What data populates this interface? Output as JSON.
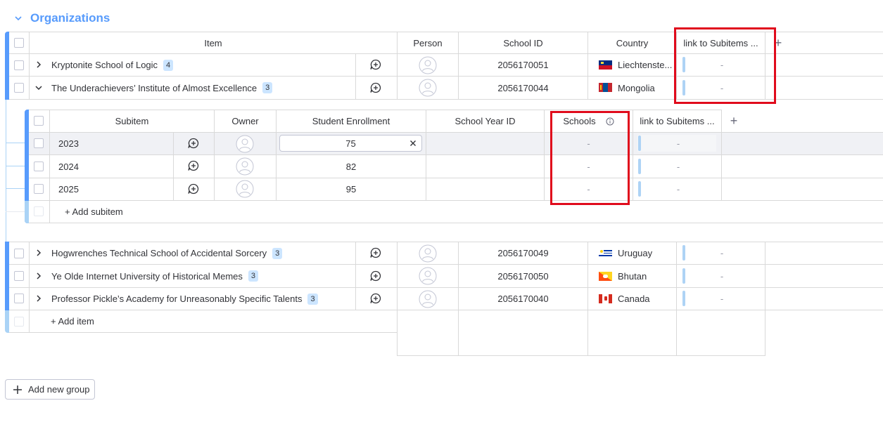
{
  "group": {
    "title": "Organizations",
    "columns": {
      "item": "Item",
      "person": "Person",
      "school_id": "School ID",
      "country": "Country",
      "link": "link to Subitems ...",
      "add": "+"
    },
    "items": [
      {
        "name": "Kryptonite School of Logic",
        "count": "4",
        "school_id": "2056170051",
        "country": "Liechtenste...",
        "flag": "liechtenstein-flag-icon",
        "link": "-"
      },
      {
        "name": "The Underachievers’ Institute of Almost Excellence",
        "count": "3",
        "school_id": "2056170044",
        "country": "Mongolia",
        "flag": "mongolia-flag-icon",
        "link": "-"
      },
      {
        "name": "Hogwrenches Technical School of Accidental Sorcery",
        "count": "3",
        "school_id": "2056170049",
        "country": "Uruguay",
        "flag": "uruguay-flag-icon",
        "link": "-"
      },
      {
        "name": "Ye Olde Internet University of Historical Memes",
        "count": "3",
        "school_id": "2056170050",
        "country": "Bhutan",
        "flag": "bhutan-flag-icon",
        "link": "-"
      },
      {
        "name": "Professor Pickle’s Academy for Unreasonably Specific Talents",
        "count": "3",
        "school_id": "2056170040",
        "country": "Canada",
        "flag": "canada-flag-icon",
        "link": "-"
      }
    ],
    "add_item": "+ Add item"
  },
  "subitems": {
    "columns": {
      "subitem": "Subitem",
      "owner": "Owner",
      "enrollment": "Student Enrollment",
      "year_id": "School Year ID",
      "schools": "Schools",
      "link": "link to Subitems ...",
      "add": "+"
    },
    "rows": [
      {
        "name": "2023",
        "enrollment": "75",
        "schools": "-",
        "link": "-"
      },
      {
        "name": "2024",
        "enrollment": "82",
        "schools": "-",
        "link": "-"
      },
      {
        "name": "2025",
        "enrollment": "95",
        "schools": "-",
        "link": "-"
      }
    ],
    "add_subitem": "+ Add subitem"
  },
  "add_new_group": "Add new group",
  "colors": {
    "group_accent": "#579bfc",
    "highlight": "#e00b1c",
    "badge": "#cce5ff"
  },
  "icons": [
    "chevron-down-icon",
    "chevron-right-icon",
    "add-update-icon",
    "person-avatar-icon",
    "info-icon",
    "clear-icon",
    "plus-icon"
  ]
}
